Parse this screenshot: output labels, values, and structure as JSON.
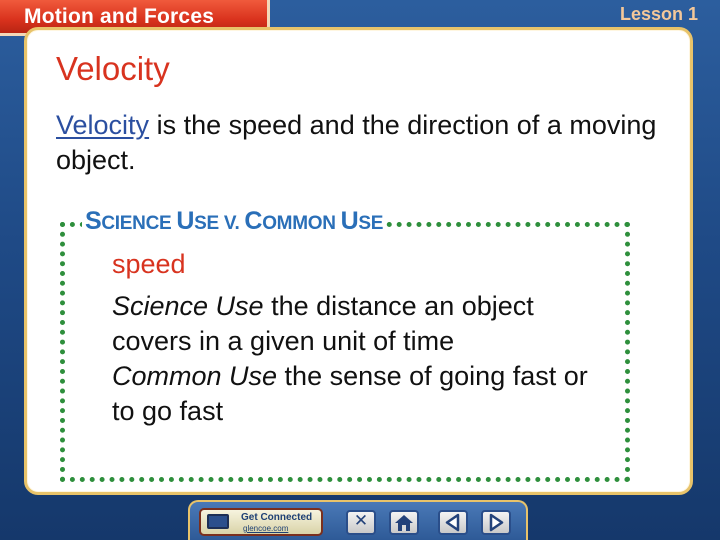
{
  "header": {
    "title": "Motion and Forces",
    "lesson": "Lesson 1"
  },
  "slide": {
    "heading": "Velocity",
    "definition_term": "Velocity",
    "definition_rest": " is the speed and the direction of a moving object."
  },
  "usage_box": {
    "title_part1": "S",
    "title_part2": "CIENCE ",
    "title_part3": "U",
    "title_part4": "SE V. ",
    "title_part5": "C",
    "title_part6": "OMMON ",
    "title_part7": "U",
    "title_part8": "SE",
    "word": "speed",
    "science_label": "Science Use",
    "science_text": " the distance an object covers in a given unit of time",
    "common_label": "Common Use",
    "common_text": " the sense of going fast or to go fast"
  },
  "nav": {
    "get_connected": "Get Connected",
    "site": "glencoe.com",
    "icons": [
      "computer-icon",
      "close-icon",
      "home-icon",
      "previous-icon",
      "next-icon"
    ]
  },
  "colors": {
    "accent_red": "#d8331f",
    "link_blue": "#2b4fa0",
    "box_green": "#2e8f3c",
    "title_blue": "#2a6fb8"
  }
}
